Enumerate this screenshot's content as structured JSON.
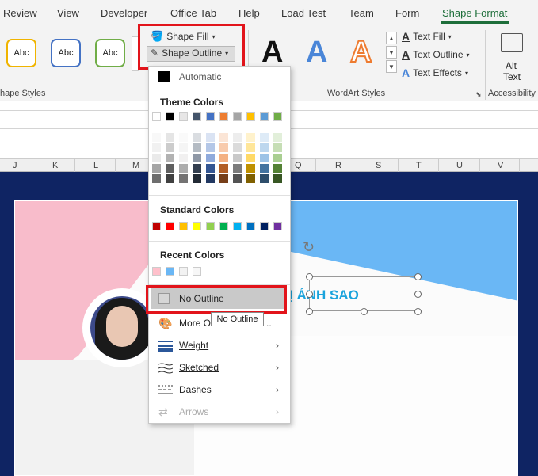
{
  "tabs": {
    "review": "Review",
    "view": "View",
    "developer": "Developer",
    "office_tab": "Office Tab",
    "help": "Help",
    "load_test": "Load Test",
    "team": "Team",
    "form": "Form",
    "shape_format": "Shape Format"
  },
  "ribbon": {
    "abc": [
      "Abc",
      "Abc",
      "Abc"
    ],
    "shape_styles_label": "hape Styles",
    "shape_fill": "Shape Fill",
    "shape_outline": "Shape Outline",
    "wordart_letter": "A",
    "wordart_label": "WordArt Styles",
    "text_fill": "Text Fill",
    "text_outline": "Text Outline",
    "text_effects": "Text Effects",
    "alt_text_line1": "Alt",
    "alt_text_line2": "Text",
    "accessibility_label": "Accessibility"
  },
  "columns": [
    "J",
    "K",
    "L",
    "M",
    "Q",
    "R",
    "S",
    "T",
    "U",
    "V"
  ],
  "slide": {
    "name_text": "Ị ÁNH SAO"
  },
  "menu": {
    "automatic": "Automatic",
    "theme_colors": "Theme Colors",
    "standard_colors": "Standard Colors",
    "recent_colors": "Recent Colors",
    "no_outline": "No Outline",
    "more_outline": "More O",
    "more_outline_tail": "..",
    "weight": "Weight",
    "sketched": "Sketched",
    "dashes": "Dashes",
    "arrows": "Arrows",
    "tooltip": "No Outline"
  },
  "colors": {
    "theme_row": [
      "#ffffff",
      "#000000",
      "#e7e6e6",
      "#44546a",
      "#4472c4",
      "#ed7d31",
      "#a5a5a5",
      "#ffc000",
      "#5b9bd5",
      "#70ad47"
    ],
    "standard": [
      "#c00000",
      "#ff0000",
      "#ffc000",
      "#ffff00",
      "#92d050",
      "#00b050",
      "#00b0f0",
      "#0070c0",
      "#002060",
      "#7030a0"
    ],
    "recent": [
      "#ffc0cb",
      "#6ab7f5",
      "#f2f2f2",
      "#f7f7f7"
    ],
    "accent_green": "#1e6e3a",
    "highlight_red": "#e2141b",
    "slide_blue": "#6ab7f5",
    "slide_pink": "#f8bccb",
    "canvas_navy": "#0f2463",
    "name_color": "#1aa3dc"
  }
}
